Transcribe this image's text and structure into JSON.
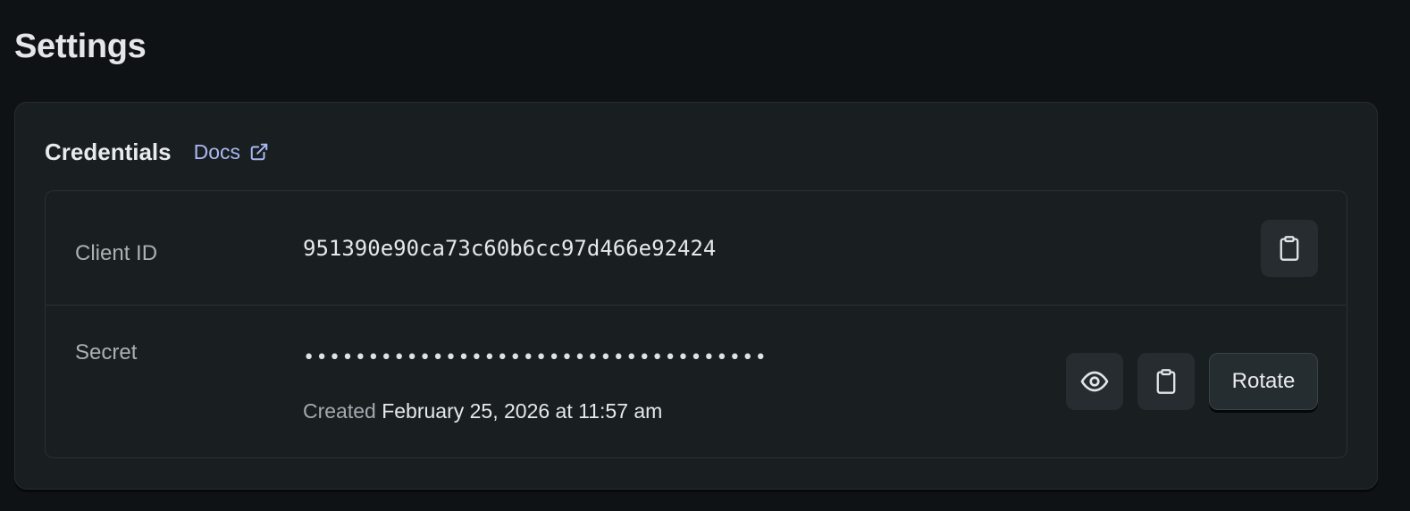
{
  "page": {
    "title": "Settings"
  },
  "credentials": {
    "title": "Credentials",
    "docs_label": "Docs",
    "client_id": {
      "label": "Client ID",
      "value": "951390e90ca73c60b6cc97d466e92424"
    },
    "secret": {
      "label": "Secret",
      "masked_value": "••••••••••••••••••••••••••••••••••••",
      "created_prefix": "Created",
      "created_date": "February 25, 2026 at 11:57 am",
      "rotate_label": "Rotate"
    }
  },
  "icons": {
    "docs": "external-link-icon",
    "copy": "clipboard-icon",
    "reveal": "eye-icon"
  },
  "colors": {
    "background": "#0e1214",
    "card": "#191e21",
    "link": "#a9b8f0",
    "button": "#262c30"
  }
}
